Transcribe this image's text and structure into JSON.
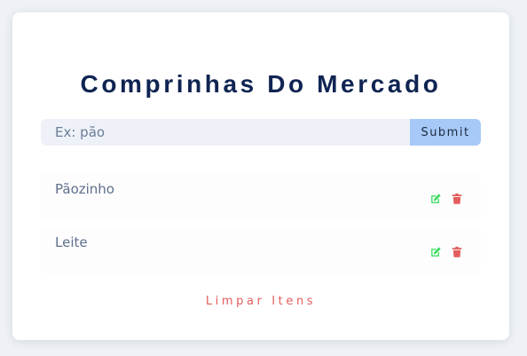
{
  "app": {
    "title": "Comprinhas Do Mercado"
  },
  "form": {
    "input_value": "",
    "input_placeholder": "Ex: pão",
    "submit_label": "Submit"
  },
  "items": [
    {
      "name": "Pãozinho",
      "edit_icon": "edit-icon",
      "delete_icon": "trash-icon"
    },
    {
      "name": "Leite",
      "edit_icon": "edit-icon",
      "delete_icon": "trash-icon"
    }
  ],
  "footer": {
    "clear_label": "Limpar Itens"
  },
  "colors": {
    "title": "#0f2452",
    "submit_bg": "#a7c9f7",
    "edit_icon": "#3ddc62",
    "delete_icon": "#e35d5d",
    "clear_text": "#e35d5d"
  }
}
